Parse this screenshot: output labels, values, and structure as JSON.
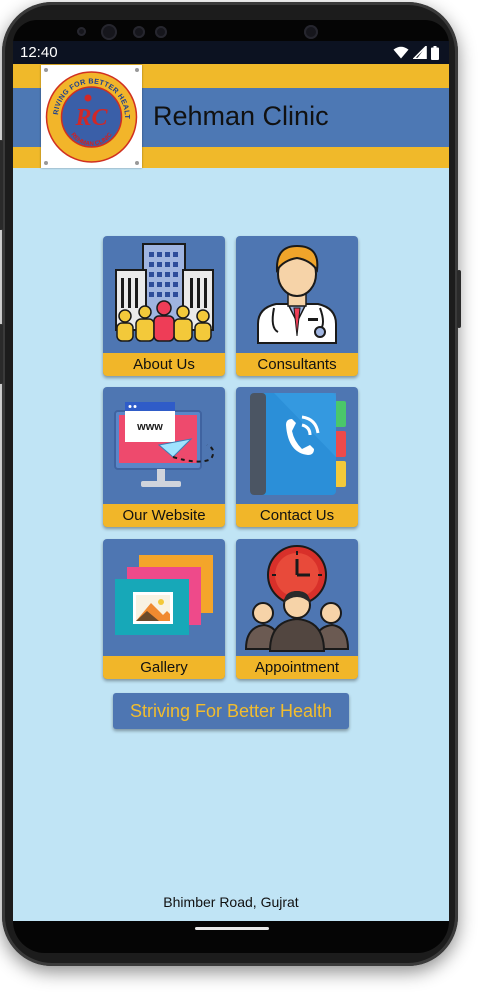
{
  "status": {
    "time": "12:40",
    "icons": [
      "wifi-icon",
      "signal-icon",
      "battery-icon"
    ]
  },
  "header": {
    "title": "Rehman Clinic",
    "logo": {
      "arc_text": "STRIVING FOR BETTER HEALTH",
      "bottom_text": "REHMAN CLINIC",
      "monogram": "RC"
    }
  },
  "tiles": [
    {
      "label": "About Us",
      "icon": "building-people-icon"
    },
    {
      "label": "Consultants",
      "icon": "doctor-icon"
    },
    {
      "label": "Our Website",
      "icon": "website-monitor-icon"
    },
    {
      "label": "Contact Us",
      "icon": "phone-book-icon"
    },
    {
      "label": "Gallery",
      "icon": "gallery-icon"
    },
    {
      "label": "Appointment",
      "icon": "appointment-clock-icon"
    }
  ],
  "tagline": "Striving For Better Health",
  "footer": "Bhimber Road, Gujrat",
  "colors": {
    "background": "#c0e4f5",
    "brand_blue": "#4e76b2",
    "brand_yellow": "#f1b629",
    "status_bar": "#0c1221"
  }
}
